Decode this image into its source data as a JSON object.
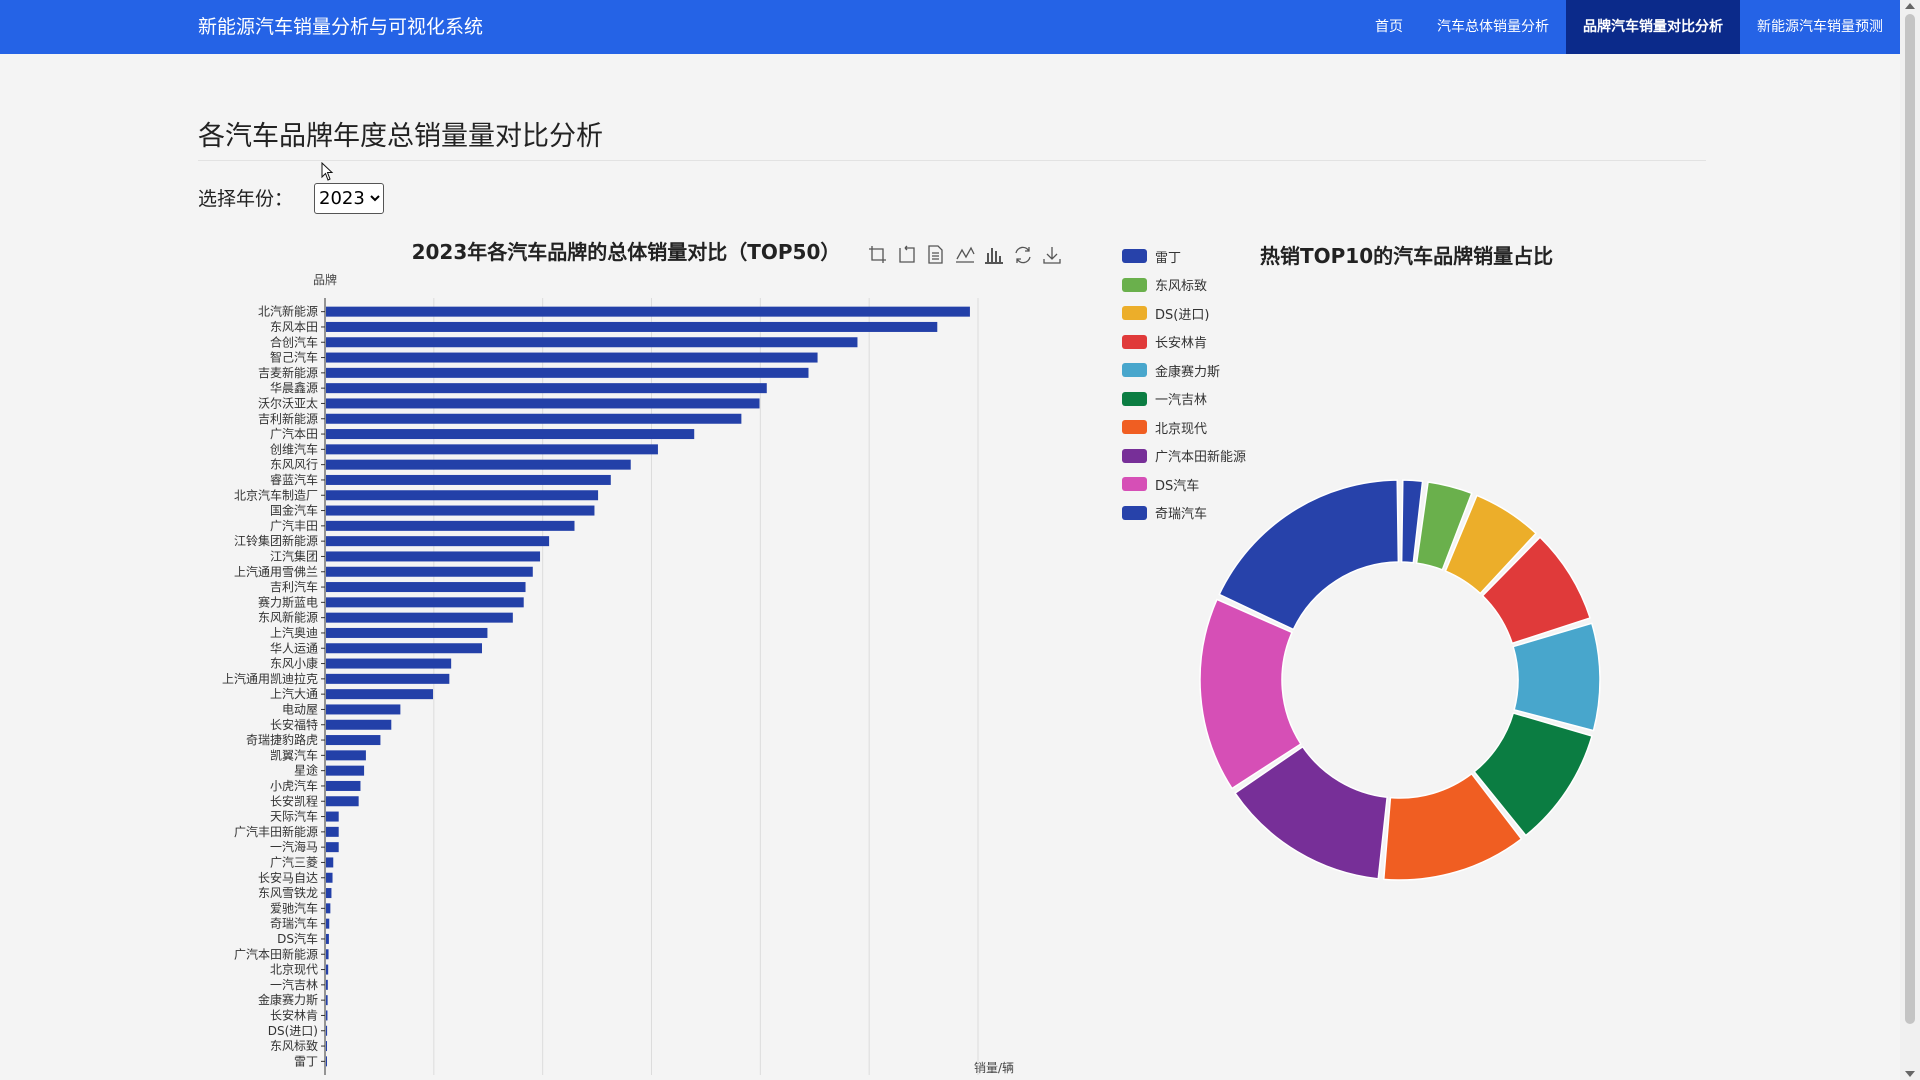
{
  "app": {
    "title": "新能源汽车销量分析与可视化系统"
  },
  "nav": [
    {
      "label": "首页",
      "active": false
    },
    {
      "label": "汽车总体销量分析",
      "active": false
    },
    {
      "label": "品牌汽车销量对比分析",
      "active": true
    },
    {
      "label": "新能源汽车销量预测",
      "active": false
    }
  ],
  "page": {
    "title": "各汽车品牌年度总销量量对比分析",
    "year_label": "选择年份：",
    "selected_year": "2023"
  },
  "toolbar": {
    "icons": [
      "zoom-icon",
      "zoom-reset-icon",
      "data-view-icon",
      "line-switch-icon",
      "bar-switch-icon",
      "restore-icon",
      "save-image-icon"
    ]
  },
  "chart_data": [
    {
      "type": "bar",
      "orientation": "horizontal",
      "title": "2023年各汽车品牌的总体销量对比（TOP50）",
      "ylabel": "品牌",
      "xlabel": "销量/辆",
      "xlim": [
        0,
        18000
      ],
      "x_ticks": [
        "0",
        "3,000",
        "6,000",
        "9,000",
        "12,000",
        "15,000",
        "18,000"
      ],
      "grid": true,
      "bar_color": "#2340a8",
      "categories": [
        "北汽新能源",
        "东风本田",
        "合创汽车",
        "智己汽车",
        "吉麦新能源",
        "华晨鑫源",
        "沃尔沃亚太",
        "吉利新能源",
        "广汽本田",
        "创维汽车",
        "东风风行",
        "睿蓝汽车",
        "北京汽车制造厂",
        "国金汽车",
        "广汽丰田",
        "江铃集团新能源",
        "江汽集团",
        "上汽通用雪佛兰",
        "吉利汽车",
        "赛力斯蓝电",
        "东风新能源",
        "上汽奥迪",
        "华人运通",
        "东风小康",
        "上汽通用凯迪拉克",
        "上汽大通",
        "电动屋",
        "长安福特",
        "奇瑞捷豹路虎",
        "凯翼汽车",
        "星途",
        "小虎汽车",
        "长安凯程",
        "天际汽车",
        "广汽丰田新能源",
        "一汽海马",
        "广汽三菱",
        "长安马自达",
        "东风雪铁龙",
        "爱驰汽车",
        "奇瑞汽车",
        "DS汽车",
        "广汽本田新能源",
        "北京现代",
        "一汽吉林",
        "金康赛力斯",
        "长安林肯",
        "DS(进口)",
        "东风标致",
        "雷丁"
      ],
      "values": [
        17750,
        16850,
        14650,
        13550,
        13300,
        12150,
        11950,
        11450,
        10150,
        9150,
        8400,
        7850,
        7500,
        7400,
        6850,
        6150,
        5900,
        5700,
        5500,
        5450,
        5150,
        4450,
        4300,
        3450,
        3400,
        2950,
        2050,
        1800,
        1500,
        1100,
        1050,
        950,
        900,
        350,
        350,
        350,
        200,
        180,
        150,
        120,
        90,
        80,
        70,
        60,
        50,
        45,
        40,
        30,
        20,
        10
      ]
    },
    {
      "type": "pie",
      "style": "donut",
      "title": "热销TOP10的汽车品牌销量占比",
      "legend_position": "top-left",
      "slices": [
        {
          "name": "雷丁",
          "value": 10,
          "color": "#2742aa"
        },
        {
          "name": "东风标致",
          "value": 20,
          "color": "#6ab04c"
        },
        {
          "name": "DS(进口)",
          "value": 30,
          "color": "#ecae2a"
        },
        {
          "name": "长安林肯",
          "value": 40,
          "color": "#e03a3a"
        },
        {
          "name": "金康赛力斯",
          "value": 45,
          "color": "#48a6cc"
        },
        {
          "name": "一汽吉林",
          "value": 50,
          "color": "#0b7d42"
        },
        {
          "name": "北京现代",
          "value": 60,
          "color": "#f05e22"
        },
        {
          "name": "广汽本田新能源",
          "value": 70,
          "color": "#772f98"
        },
        {
          "name": "DS汽车",
          "value": 80,
          "color": "#d64fb6"
        },
        {
          "name": "奇瑞汽车",
          "value": 90,
          "color": "#2742aa"
        }
      ]
    }
  ]
}
